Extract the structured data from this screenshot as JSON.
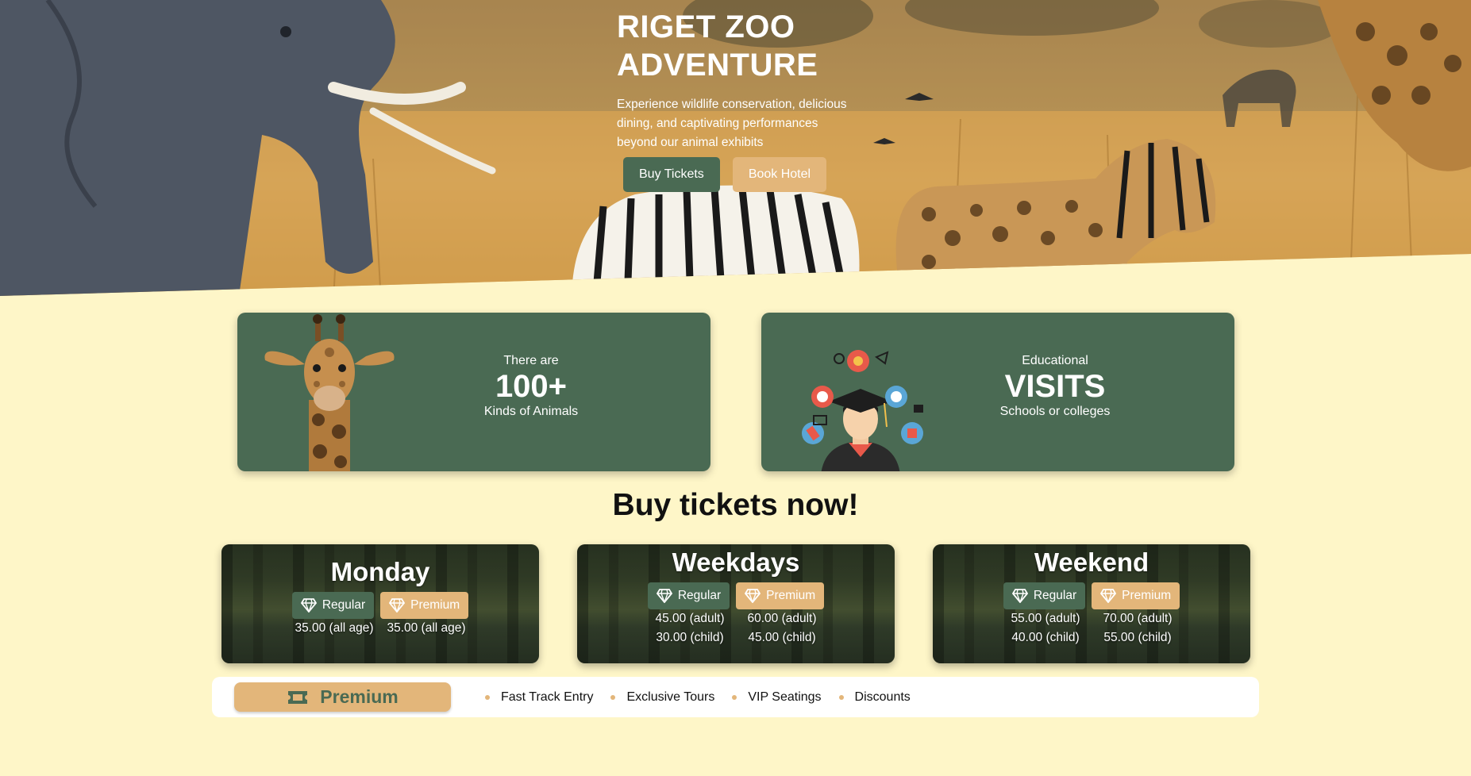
{
  "hero": {
    "title": "RIGET ZOO ADVENTURE",
    "subtitle": "Experience wildlife conservation, delicious dining, and captivating performances beyond our animal exhibits",
    "buy_label": "Buy Tickets",
    "hotel_label": "Book Hotel"
  },
  "stats": [
    {
      "pre": "There are",
      "big": "100+",
      "post": "Kinds of Animals",
      "image": "giraffe-head"
    },
    {
      "pre": "Educational",
      "big": "VISITS",
      "post": "Schools or colleges",
      "image": "graduate"
    }
  ],
  "tickets": {
    "heading": "Buy tickets now!",
    "regular_label": "Regular",
    "premium_label": "Premium",
    "cards": [
      {
        "title": "Monday",
        "regular": [
          "35.00 (all age)"
        ],
        "premium": [
          "35.00 (all age)"
        ]
      },
      {
        "title": "Weekdays",
        "regular": [
          "45.00 (adult)",
          "30.00 (child)"
        ],
        "premium": [
          "60.00 (adult)",
          "45.00 (child)"
        ]
      },
      {
        "title": "Weekend",
        "regular": [
          "55.00 (adult)",
          "40.00 (child)"
        ],
        "premium": [
          "70.00 (adult)",
          "55.00 (child)"
        ]
      }
    ]
  },
  "premium_bar": {
    "label": "Premium",
    "icon": "ticket-icon",
    "perks": [
      "Fast Track Entry",
      "Exclusive Tours",
      "VIP Seatings",
      "Discounts"
    ]
  },
  "colors": {
    "green": "#4a6a53",
    "tan": "#e3b67a",
    "page_bg": "#fef6c8"
  }
}
